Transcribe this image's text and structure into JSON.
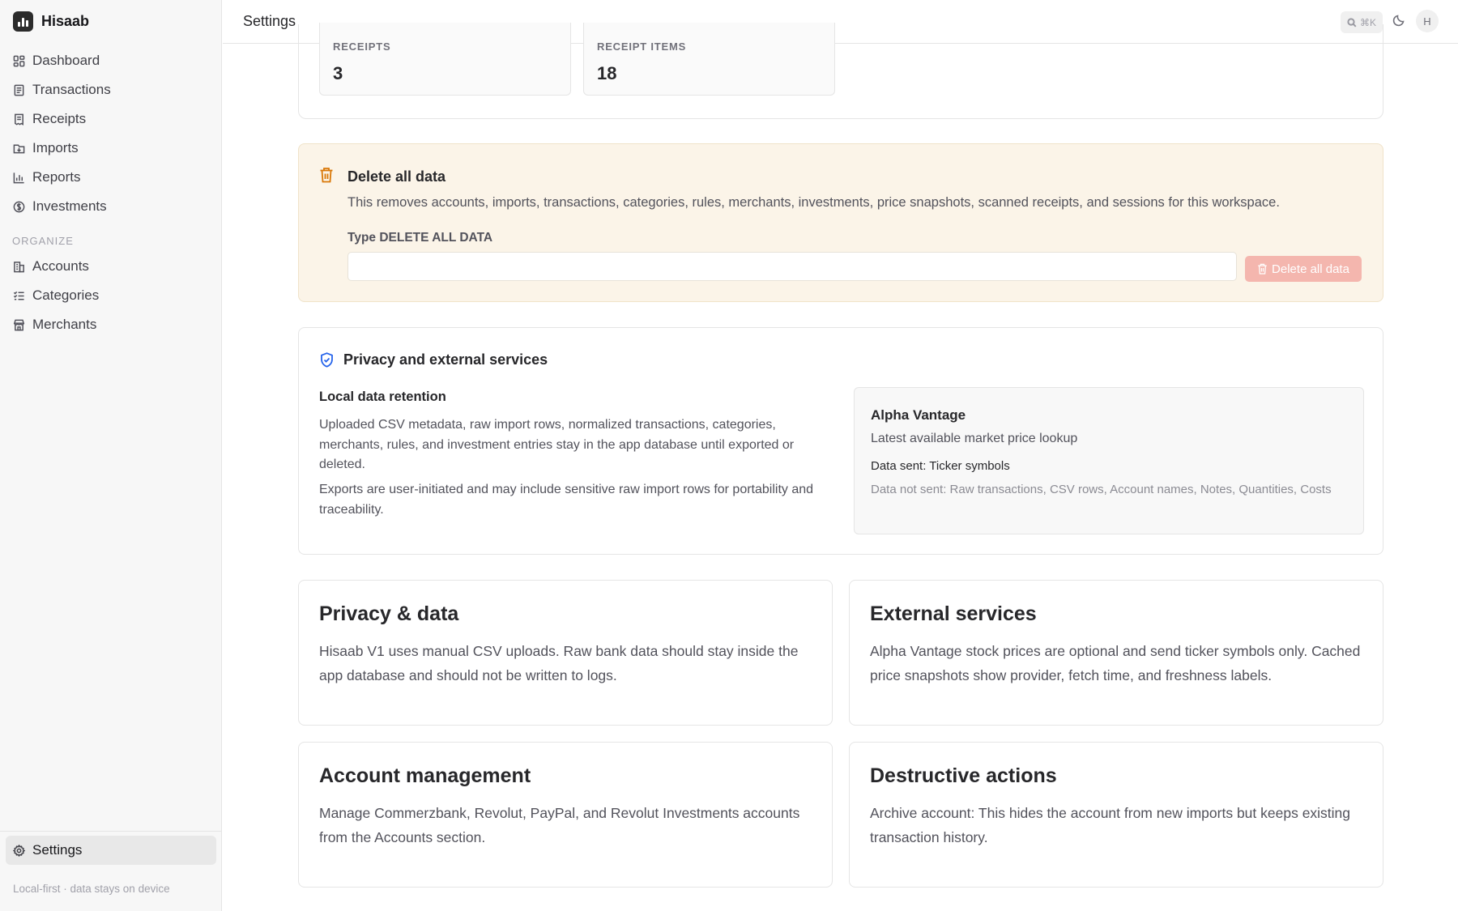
{
  "app": {
    "name": "Hisaab"
  },
  "sidebar": {
    "main_items": [
      {
        "label": "Dashboard",
        "icon": "dashboard-icon"
      },
      {
        "label": "Transactions",
        "icon": "transactions-icon"
      },
      {
        "label": "Receipts",
        "icon": "receipts-icon"
      },
      {
        "label": "Imports",
        "icon": "imports-icon"
      },
      {
        "label": "Reports",
        "icon": "reports-icon"
      },
      {
        "label": "Investments",
        "icon": "investments-icon"
      }
    ],
    "section_label": "ORGANIZE",
    "organize_items": [
      {
        "label": "Accounts",
        "icon": "accounts-icon"
      },
      {
        "label": "Categories",
        "icon": "categories-icon"
      },
      {
        "label": "Merchants",
        "icon": "merchants-icon"
      }
    ],
    "settings_label": "Settings",
    "footer_note": "Local-first · data stays on device"
  },
  "topbar": {
    "title": "Settings",
    "search_shortcut": "⌘K",
    "avatar_initial": "H"
  },
  "stats": [
    {
      "label": "RECEIPTS",
      "value": "3"
    },
    {
      "label": "RECEIPT ITEMS",
      "value": "18"
    }
  ],
  "danger": {
    "title": "Delete all data",
    "description": "This removes accounts, imports, transactions, categories, rules, merchants, investments, price snapshots, scanned receipts, and sessions for this workspace.",
    "confirm_label": "Type DELETE ALL DATA",
    "input_value": "",
    "button_label": "Delete all data",
    "accent_color": "#d97706",
    "button_color": "#f4b6ae"
  },
  "privacy": {
    "title": "Privacy and external services",
    "retention_title": "Local data retention",
    "retention_p1": "Uploaded CSV metadata, raw import rows, normalized transactions, categories, merchants, rules, and investment entries stay in the app database until exported or deleted.",
    "retention_p2": "Exports are user-initiated and may include sensitive raw import rows for portability and traceability.",
    "service": {
      "name": "Alpha Vantage",
      "purpose": "Latest available market price lookup",
      "data_sent": "Data sent: Ticker symbols",
      "data_not_sent": "Data not sent: Raw transactions, CSV rows, Account names, Notes, Quantities, Costs"
    },
    "accent_color": "#2563eb"
  },
  "info_cards": [
    {
      "title": "Privacy & data",
      "body": "Hisaab V1 uses manual CSV uploads. Raw bank data should stay inside the app database and should not be written to logs."
    },
    {
      "title": "External services",
      "body": "Alpha Vantage stock prices are optional and send ticker symbols only. Cached price snapshots show provider, fetch time, and freshness labels."
    },
    {
      "title": "Account management",
      "body": "Manage Commerzbank, Revolut, PayPal, and Revolut Investments accounts from the Accounts section."
    },
    {
      "title": "Destructive actions",
      "body": "Archive account: This hides the account from new imports but keeps existing transaction history."
    }
  ]
}
